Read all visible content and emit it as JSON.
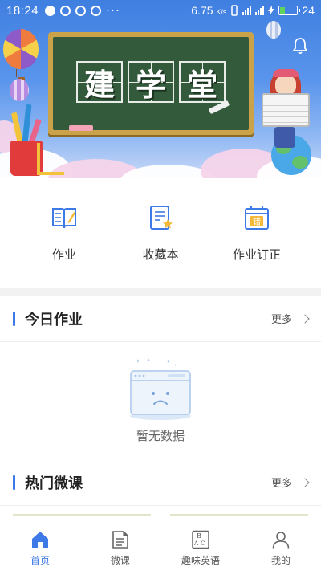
{
  "status_bar": {
    "time": "18:24",
    "speed_value": "6.75",
    "speed_unit": "K/s",
    "battery": "24"
  },
  "banner": {
    "board_chars": [
      "建",
      "学",
      "堂"
    ]
  },
  "quick_entries": [
    {
      "label": "作业",
      "icon": "book-pen-icon"
    },
    {
      "label": "收藏本",
      "icon": "star-notebook-icon"
    },
    {
      "label": "作业订正",
      "icon": "calendar-correct-icon"
    }
  ],
  "quick_badge": "错",
  "today": {
    "title": "今日作业",
    "more": "更多",
    "empty_text": "暂无数据"
  },
  "hot_courses": {
    "title": "热门微课",
    "more": "更多"
  },
  "tabs": [
    {
      "label": "首页",
      "icon": "home-icon",
      "active": true
    },
    {
      "label": "微课",
      "icon": "document-icon",
      "active": false
    },
    {
      "label": "趣味英语",
      "icon": "abc-card-icon",
      "active": false
    },
    {
      "label": "我的",
      "icon": "person-icon",
      "active": false
    }
  ],
  "colors": {
    "accent": "#3e79e8",
    "board": "#335a3b",
    "banner_top": "#3f7fe0"
  }
}
